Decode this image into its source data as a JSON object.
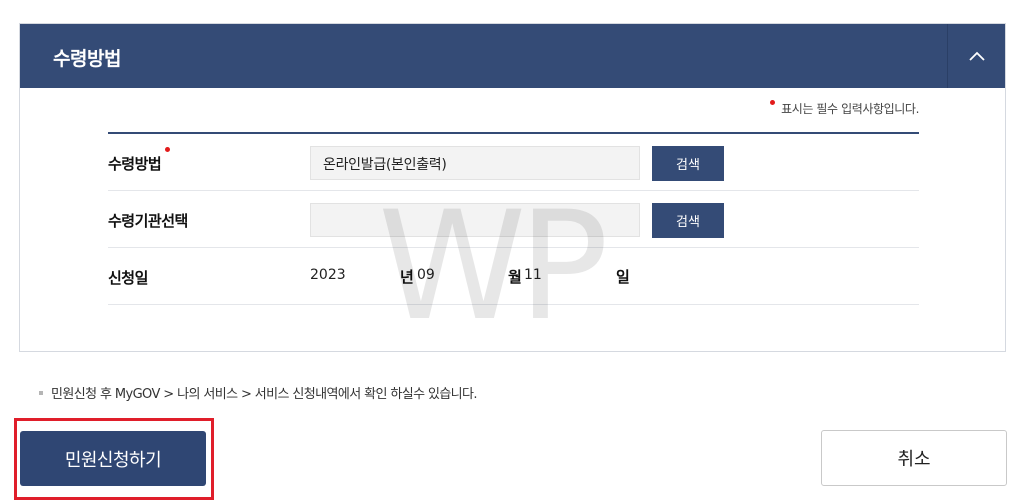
{
  "panel": {
    "title": "수령방법",
    "required_note": "표시는 필수 입력사항입니다."
  },
  "form": {
    "receive_method": {
      "label": "수령방법",
      "value": "온라인발급(본인출력)",
      "search_label": "검색"
    },
    "receive_org": {
      "label": "수령기관선택",
      "value": "",
      "search_label": "검색"
    },
    "apply_date": {
      "label": "신청일",
      "year": "2023",
      "year_unit": "년",
      "month": "09",
      "month_unit": "월",
      "day": "11",
      "day_unit": "일"
    }
  },
  "watermark": "WP",
  "info_text": "민원신청 후 MyGOV > 나의 서비스 > 서비스 신청내역에서 확인 하실수 있습니다.",
  "actions": {
    "apply_label": "민원신청하기",
    "cancel_label": "취소"
  },
  "colors": {
    "primary": "#344b76",
    "required": "#e21b1b",
    "highlight": "#e01e2a"
  }
}
